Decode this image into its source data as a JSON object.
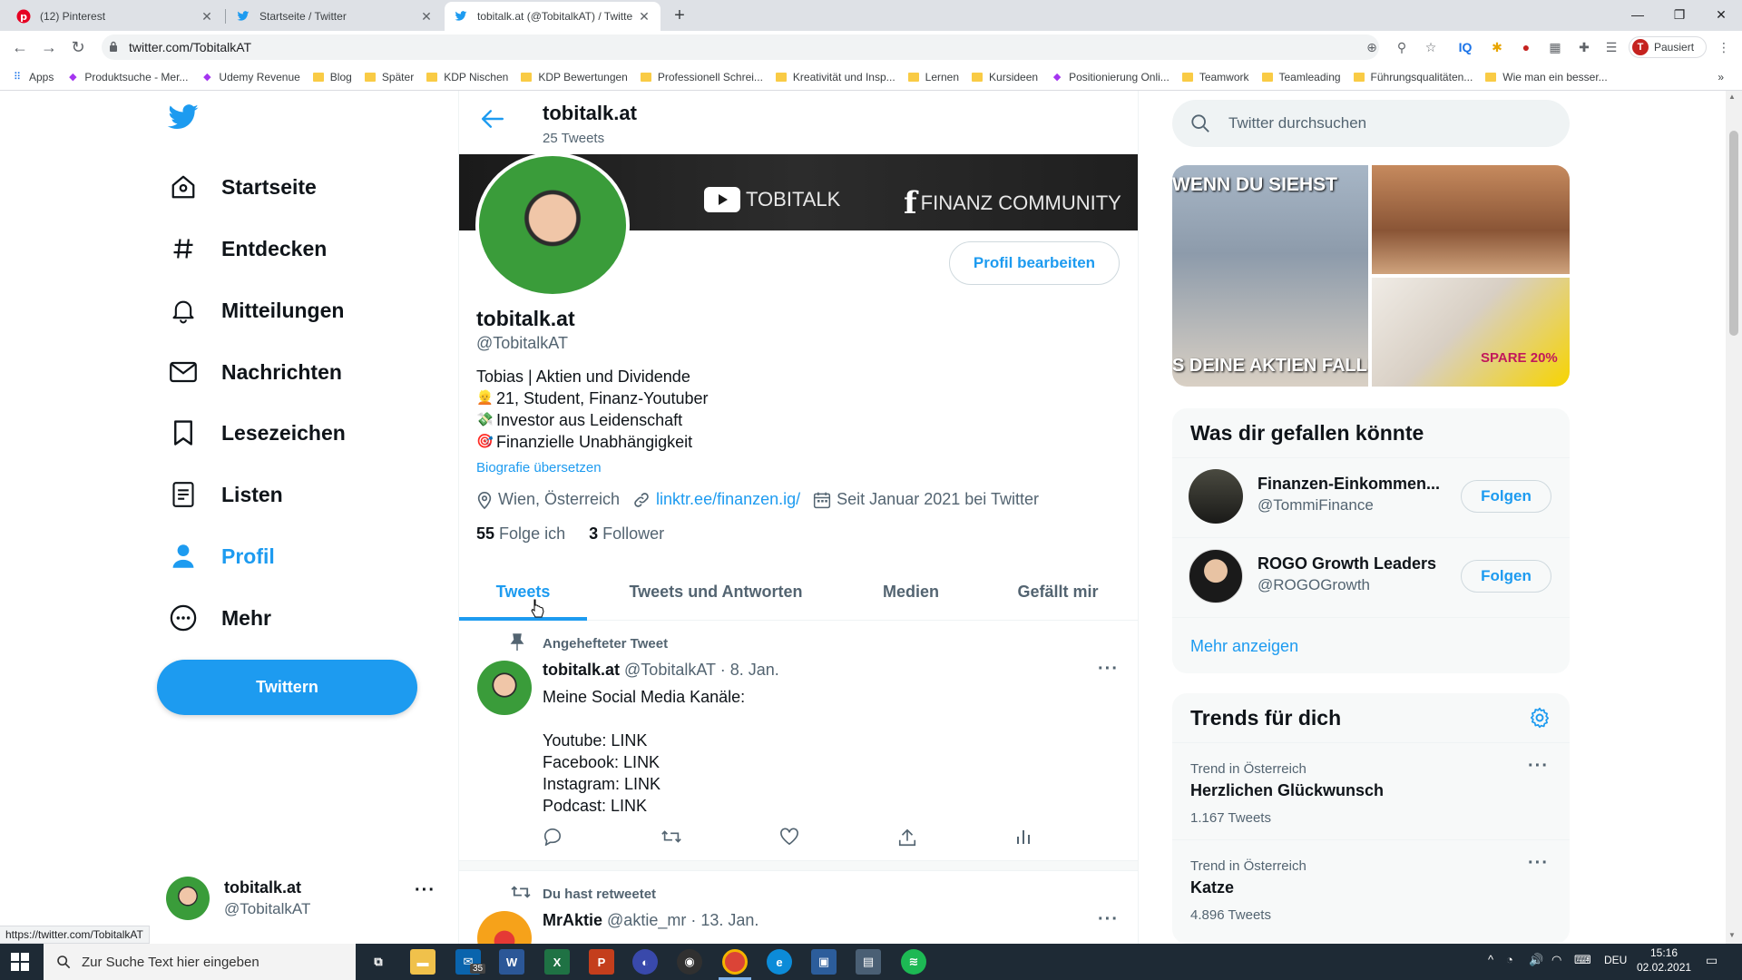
{
  "browser": {
    "tabs": [
      {
        "label": "(12) Pinterest"
      },
      {
        "label": "Startseite / Twitter"
      },
      {
        "label": "tobitalk.at (@TobitalkAT) / Twitte"
      }
    ],
    "url": "twitter.com/TobitalkAT",
    "profile_label": "Pausiert",
    "profile_initial": "T",
    "status_link": "https://twitter.com/TobitalkAT",
    "bookmarks": [
      {
        "label": "Apps",
        "type": "apps"
      },
      {
        "label": "Produktsuche - Mer...",
        "type": "site"
      },
      {
        "label": "Udemy Revenue",
        "type": "site"
      },
      {
        "label": "Blog",
        "type": "folder"
      },
      {
        "label": "Später",
        "type": "folder"
      },
      {
        "label": "KDP Nischen",
        "type": "folder"
      },
      {
        "label": "KDP Bewertungen",
        "type": "folder"
      },
      {
        "label": "Professionell Schrei...",
        "type": "folder"
      },
      {
        "label": "Kreativität und Insp...",
        "type": "folder"
      },
      {
        "label": "Lernen",
        "type": "folder"
      },
      {
        "label": "Kursideen",
        "type": "folder"
      },
      {
        "label": "Positionierung Onli...",
        "type": "site"
      },
      {
        "label": "Teamwork",
        "type": "folder"
      },
      {
        "label": "Teamleading",
        "type": "folder"
      },
      {
        "label": "Führungsqualitäten...",
        "type": "folder"
      },
      {
        "label": "Wie man ein besser...",
        "type": "folder"
      }
    ]
  },
  "nav": {
    "items": [
      {
        "label": "Startseite"
      },
      {
        "label": "Entdecken"
      },
      {
        "label": "Mitteilungen"
      },
      {
        "label": "Nachrichten"
      },
      {
        "label": "Lesezeichen"
      },
      {
        "label": "Listen"
      },
      {
        "label": "Profil"
      },
      {
        "label": "Mehr"
      }
    ],
    "tweet_button": "Twittern",
    "account_name": "tobitalk.at",
    "account_handle": "@TobitalkAT"
  },
  "header": {
    "title": "tobitalk.at",
    "tweet_count": "25 Tweets"
  },
  "banner": {
    "youtube": "TOBITALK",
    "facebook": "FINANZ COMMUNITY"
  },
  "profile": {
    "edit_button": "Profil bearbeiten",
    "name": "tobitalk.at",
    "handle": "@TobitalkAT",
    "bio": [
      "Tobias | Aktien und Dividende",
      "21, Student, Finanz-Youtuber",
      "Investor aus Leidenschaft",
      "Finanzielle Unabhängigkeit"
    ],
    "translate_bio": "Biografie übersetzen",
    "location": "Wien, Österreich",
    "link": "linktr.ee/finanzen.ig/",
    "joined": "Seit Januar 2021 bei Twitter",
    "following_count": "55",
    "following_label": "Folge ich",
    "followers_count": "3",
    "followers_label": "Follower"
  },
  "profile_tabs": [
    {
      "label": "Tweets"
    },
    {
      "label": "Tweets und Antworten"
    },
    {
      "label": "Medien"
    },
    {
      "label": "Gefällt mir"
    }
  ],
  "pinned_tweet": {
    "context": "Angehefteter Tweet",
    "name": "tobitalk.at",
    "handle": "@TobitalkAT",
    "date": "· 8. Jan.",
    "lines": [
      "Meine Social Media Kanäle:",
      "",
      "Youtube: LINK",
      "Facebook: LINK",
      "Instagram: LINK",
      "Podcast: LINK"
    ]
  },
  "retweet": {
    "context": "Du hast retweetet",
    "name": "MrAktie",
    "handle": "@aktie_mr",
    "date": "· 13. Jan."
  },
  "search": {
    "placeholder": "Twitter durchsuchen"
  },
  "media_tiles": {
    "meme_top": "WENN DU SIEHST",
    "meme_bottom": "S DEINE AKTIEN FALLEN",
    "ad_text": "SPARE 20%"
  },
  "who_to_follow": {
    "title": "Was dir gefallen könnte",
    "accounts": [
      {
        "name": "Finanzen-Einkommen...",
        "handle": "@TommiFinance",
        "button": "Folgen"
      },
      {
        "name": "ROGO Growth Leaders",
        "handle": "@ROGOGrowth",
        "button": "Folgen"
      }
    ],
    "show_more": "Mehr anzeigen"
  },
  "trends": {
    "title": "Trends für dich",
    "items": [
      {
        "context": "Trend in Österreich",
        "name": "Herzlichen Glückwunsch",
        "count": "1.167 Tweets"
      },
      {
        "context": "Trend in Österreich",
        "name": "Katze",
        "count": "4.896 Tweets"
      }
    ]
  },
  "taskbar": {
    "search_placeholder": "Zur Suche Text hier eingeben",
    "mail_badge": "35",
    "language": "DEU",
    "time": "15:16",
    "date": "02.02.2021"
  },
  "colors": {
    "twitter_blue": "#1d9bf0",
    "text_primary": "#0f1419",
    "text_secondary": "#536471"
  }
}
